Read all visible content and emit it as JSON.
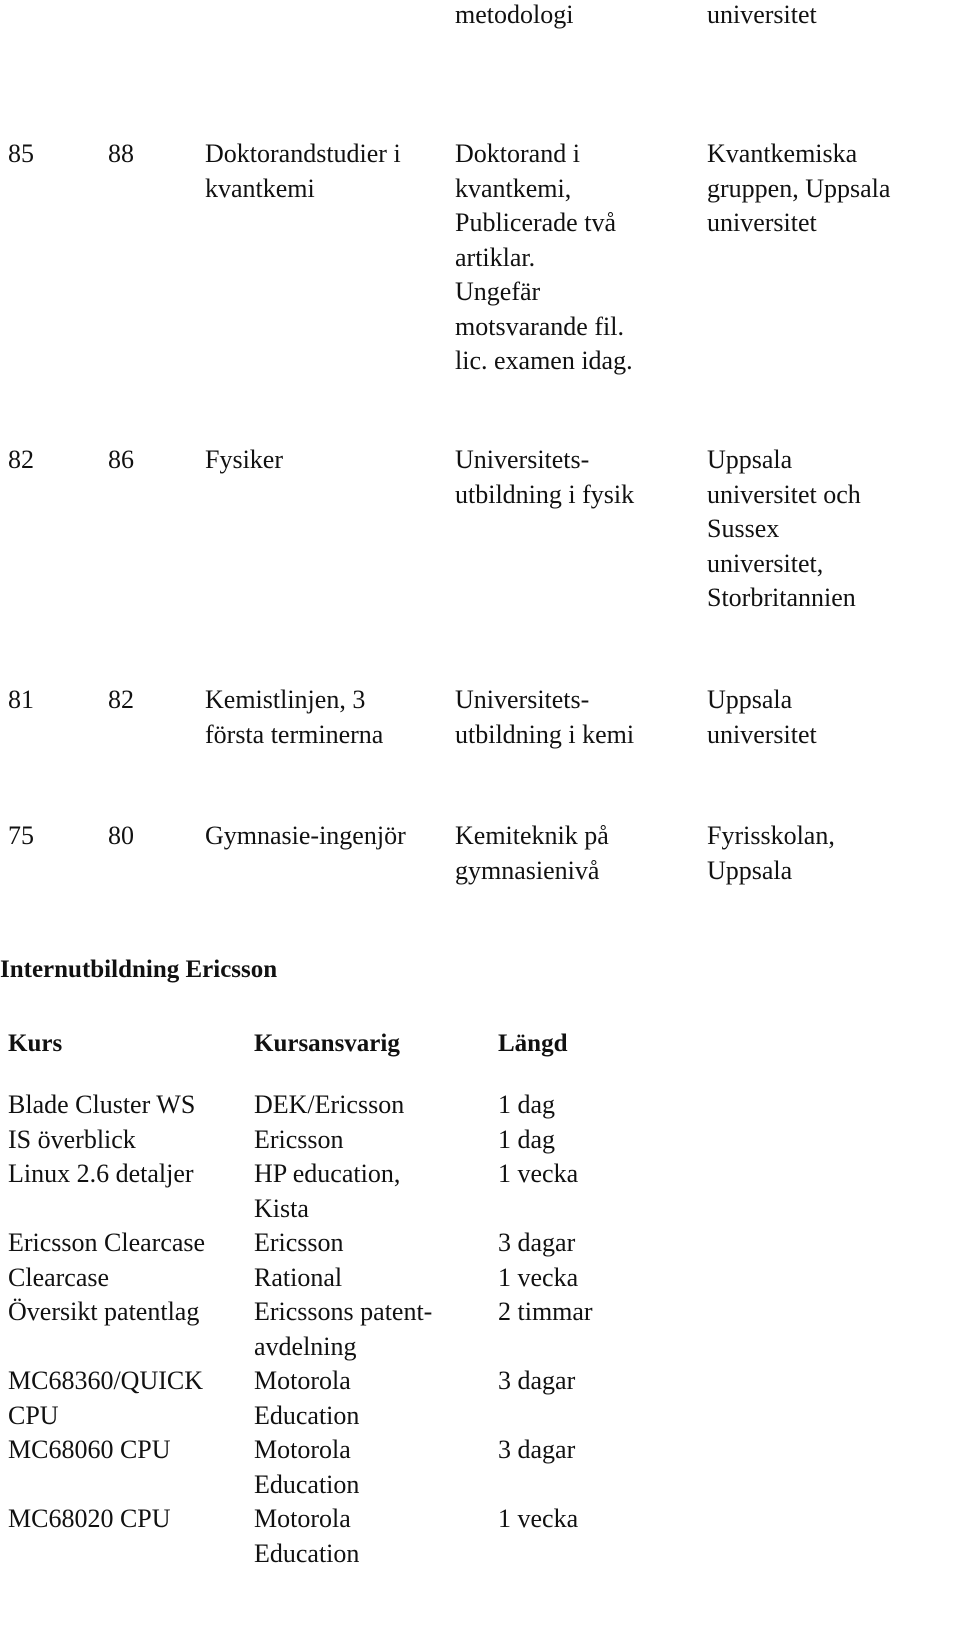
{
  "education": {
    "partial_top_row": {
      "col4": "metodologi",
      "col5": "universitet"
    },
    "rows": [
      {
        "from": "85",
        "to": "88",
        "program": "Doktorandstudier i\nkvantkemi",
        "description": "Doktorand i\nkvantkemi,\nPublicerade  två\nartiklar.\nUngefär\nmotsvarande fil.\nlic. examen idag.",
        "institution": "Kvantkemiska\ngruppen, Uppsala\nuniversitet"
      },
      {
        "from": "82",
        "to": "86",
        "program": "Fysiker",
        "description": "Universitets-\nutbildning i fysik",
        "institution": "Uppsala\nuniversitet och\nSussex\nuniversitet,\nStorbritannien"
      },
      {
        "from": "81",
        "to": "82",
        "program": "Kemistlinjen, 3\nförsta terminerna",
        "description": "Universitets-\nutbildning i kemi",
        "institution": "Uppsala\nuniversitet"
      },
      {
        "from": "75",
        "to": "80",
        "program": "Gymnasie-ingenjör",
        "description": "Kemiteknik på\ngymnasienivå",
        "institution": "Fyrisskolan,\nUppsala"
      }
    ]
  },
  "internal_training": {
    "heading": "Internutbildning Ericsson",
    "columns": [
      "Kurs",
      "Kursansvarig",
      "Längd"
    ],
    "rows": [
      {
        "course": "Blade Cluster WS",
        "responsible": "DEK/Ericsson",
        "length": "1 dag"
      },
      {
        "course": "IS överblick",
        "responsible": "Ericsson",
        "length": "1 dag"
      },
      {
        "course": "Linux 2.6 detaljer",
        "responsible": "HP education,\nKista",
        "length": "1 vecka"
      },
      {
        "course": "Ericsson Clearcase",
        "responsible": "Ericsson",
        "length": "3 dagar"
      },
      {
        "course": "Clearcase",
        "responsible": "Rational",
        "length": "1 vecka"
      },
      {
        "course": "Översikt  patentlag",
        "responsible": "Ericssons patent-\navdelning",
        "length": "2 timmar"
      },
      {
        "course": "MC68360/QUICK\nCPU",
        "responsible": "Motorola\nEducation",
        "length": "3 dagar"
      },
      {
        "course": "MC68060 CPU",
        "responsible": "Motorola\nEducation",
        "length": "3 dagar"
      },
      {
        "course": "MC68020 CPU",
        "responsible": "Motorola\nEducation",
        "length": "1 vecka"
      }
    ]
  }
}
